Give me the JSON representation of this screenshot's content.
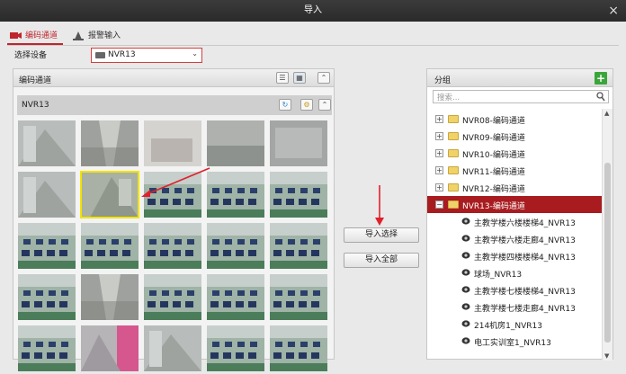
{
  "window": {
    "title": "导入",
    "close_glyph": "×"
  },
  "tabs": [
    {
      "label": "编码通道",
      "active": true
    },
    {
      "label": "报警输入",
      "active": false
    }
  ],
  "device": {
    "label": "选择设备",
    "value": "NVR13"
  },
  "left_panel": {
    "title": "编码通道",
    "subgroup": "NVR13",
    "thumbnails": [
      {
        "scene": "stairs"
      },
      {
        "scene": "corridor"
      },
      {
        "scene": "room-bright"
      },
      {
        "scene": "room-dim"
      },
      {
        "scene": "blank"
      },
      {
        "scene": "stairs"
      },
      {
        "scene": "stairs-selected"
      },
      {
        "scene": "classroom"
      },
      {
        "scene": "classroom"
      },
      {
        "scene": "classroom"
      },
      {
        "scene": "classroom"
      },
      {
        "scene": "classroom"
      },
      {
        "scene": "classroom"
      },
      {
        "scene": "classroom"
      },
      {
        "scene": "classroom"
      },
      {
        "scene": "classroom"
      },
      {
        "scene": "corridor"
      },
      {
        "scene": "classroom"
      },
      {
        "scene": "classroom"
      },
      {
        "scene": "classroom"
      },
      {
        "scene": "classroom"
      },
      {
        "scene": "stairs-pink"
      },
      {
        "scene": "stairs"
      },
      {
        "scene": "classroom"
      },
      {
        "scene": "classroom"
      }
    ],
    "selected_index": 6
  },
  "buttons": {
    "import_selected": "导入选择",
    "import_all": "导入全部"
  },
  "right_panel": {
    "title": "分组",
    "search_placeholder": "搜索...",
    "groups": [
      {
        "label": "NVR08-编码通道",
        "expanded": false
      },
      {
        "label": "NVR09-编码通道",
        "expanded": false
      },
      {
        "label": "NVR10-编码通道",
        "expanded": false
      },
      {
        "label": "NVR11-编码通道",
        "expanded": false
      },
      {
        "label": "NVR12-编码通道",
        "expanded": false
      },
      {
        "label": "NVR13-编码通道",
        "expanded": true,
        "selected": true
      }
    ],
    "channels": [
      "主教学楼六楼楼梯4_NVR13",
      "主教学楼六楼走廊4_NVR13",
      "主教学楼四楼楼梯4_NVR13",
      "球场_NVR13",
      "主教学楼七楼楼梯4_NVR13",
      "主教学楼七楼走廊4_NVR13",
      "214机房1_NVR13",
      "电工实训室1_NVR13"
    ]
  },
  "colors": {
    "accent": "#c0242c",
    "selected_row": "#a81c20",
    "selection_outline": "#f2e300",
    "arrow": "#e0202a"
  }
}
